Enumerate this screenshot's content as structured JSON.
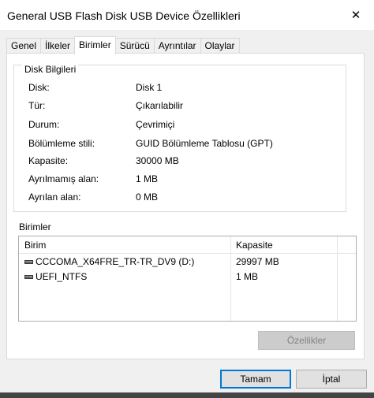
{
  "window": {
    "title": "General USB Flash Disk USB Device Özellikleri",
    "close_glyph": "✕"
  },
  "tabs": [
    {
      "label": "Genel"
    },
    {
      "label": "İlkeler"
    },
    {
      "label": "Birimler",
      "active": true
    },
    {
      "label": "Sürücü"
    },
    {
      "label": "Ayrıntılar"
    },
    {
      "label": "Olaylar"
    }
  ],
  "disk_info": {
    "group_label": "Disk Bilgileri",
    "rows": [
      {
        "key": "Disk:",
        "value": "Disk 1"
      },
      {
        "key": "Tür:",
        "value": "Çıkarılabilir"
      },
      {
        "key": "Durum:",
        "value": "Çevrimiçi"
      },
      {
        "key": "Bölümleme stili:",
        "value": "GUID Bölümleme Tablosu (GPT)"
      },
      {
        "key": "Kapasite:",
        "value": "30000 MB"
      },
      {
        "key": "Ayrılmamış alan:",
        "value": "1 MB"
      },
      {
        "key": "Ayrılan alan:",
        "value": "0 MB"
      }
    ]
  },
  "volumes": {
    "label": "Birimler",
    "columns": [
      "Birim",
      "Kapasite"
    ],
    "rows": [
      {
        "name": "CCCOMA_X64FRE_TR-TR_DV9 (D:)",
        "capacity": "29997 MB",
        "icon": "drive-icon"
      },
      {
        "name": "UEFI_NTFS",
        "capacity": "1 MB",
        "icon": "drive-icon"
      }
    ],
    "properties_button": "Özellikler"
  },
  "footer": {
    "ok_label": "Tamam",
    "cancel_label": "İptal"
  }
}
